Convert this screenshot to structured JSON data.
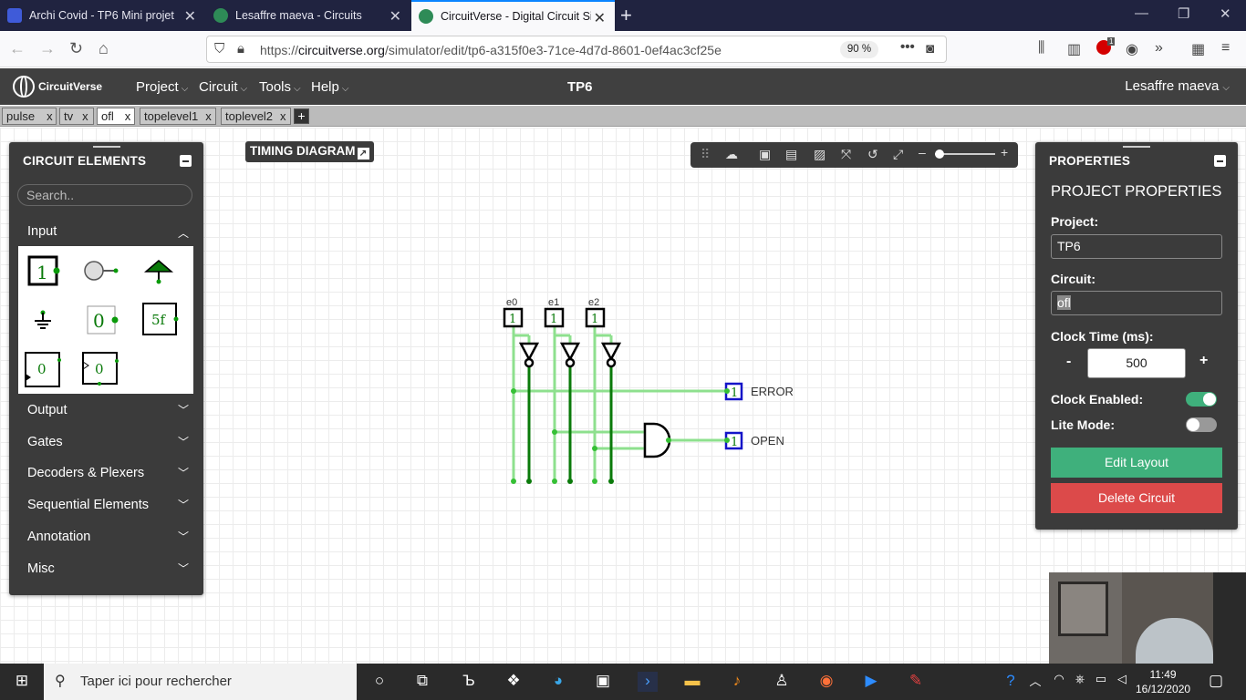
{
  "browser": {
    "tabs": [
      {
        "label": "Archi Covid - TP6 Mini projet",
        "color": "#3f5bd9"
      },
      {
        "label": "Lesaffre maeva - Circuits",
        "color": "#2e8b57"
      },
      {
        "label": "CircuitVerse - Digital Circuit Sim",
        "color": "#2e8b57"
      }
    ],
    "new_tab": "+",
    "url_prefix": "https://",
    "url_domain": "circuitverse.org",
    "url_path": "/simulator/edit/tp6-a315f0e3-71ce-4d7d-8601-0ef4ac3cf25e",
    "zoom": "90 %",
    "abp_badge": "1"
  },
  "app": {
    "logo": "CircuitVerse",
    "menus": [
      "Project",
      "Circuit",
      "Tools",
      "Help"
    ],
    "title": "TP6",
    "user": "Lesaffre maeva"
  },
  "circuit_tabs": [
    "pulse",
    "tv",
    "ofl",
    "topelevel1",
    "toplevel2"
  ],
  "circuit_tab_close": "x",
  "timing": {
    "label": "TIMING DIAGRAM"
  },
  "elements_panel": {
    "title": "CIRCUIT ELEMENTS",
    "search_placeholder": "Search..",
    "input_label": "Input",
    "categories": [
      "Output",
      "Gates",
      "Decoders & Plexers",
      "Sequential Elements",
      "Annotation",
      "Misc"
    ],
    "input_items": {
      "bit1": "1",
      "const0": "0",
      "hex": "5f",
      "clk_a": "0",
      "clk_b": "0"
    }
  },
  "properties": {
    "title": "PROPERTIES",
    "heading": "PROJECT PROPERTIES",
    "project_label": "Project:",
    "project_value": "TP6",
    "circuit_label": "Circuit:",
    "circuit_value": "ofl",
    "clock_label": "Clock Time (ms):",
    "clock_minus": "-",
    "clock_value": "500",
    "clock_plus": "+",
    "clock_enabled_label": "Clock Enabled:",
    "clock_enabled": true,
    "lite_mode_label": "Lite Mode:",
    "lite_mode": false,
    "edit_button": "Edit Layout",
    "delete_button": "Delete Circuit",
    "edit_color": "#3fb07c",
    "delete_color": "#dc4a4a"
  },
  "circuit": {
    "inputs": [
      {
        "label": "e0",
        "value": "1"
      },
      {
        "label": "e1",
        "value": "1"
      },
      {
        "label": "e2",
        "value": "1"
      }
    ],
    "outputs": [
      {
        "label": "ERROR",
        "value": "1"
      },
      {
        "label": "OPEN",
        "value": "1"
      }
    ],
    "wire_on_color": "#8ee08e",
    "wire_dark_color": "#0a7a0a"
  },
  "taskbar": {
    "search_placeholder": "Taper ici pour rechercher",
    "time": "11:49",
    "date": "16/12/2020"
  }
}
